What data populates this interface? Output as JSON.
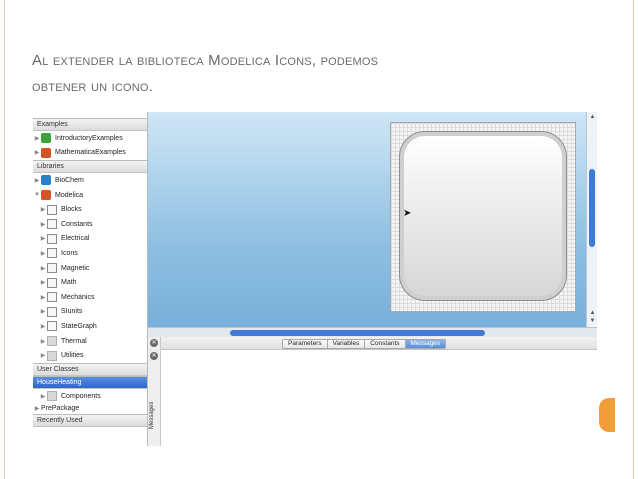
{
  "slide": {
    "title_line1": "Al extender la biblioteca Modelica Icons, podemos",
    "title_line2": "obtener un icono."
  },
  "library": {
    "sections": {
      "examples": "Examples",
      "libraries": "Libraries",
      "user_classes": "User Classes",
      "recently_used": "Recently Used"
    },
    "examples": [
      {
        "label": "IntroductoryExamples",
        "icon": "green-package-icon"
      },
      {
        "label": "MathematicaExamples",
        "icon": "mathematica-icon"
      }
    ],
    "libraries": {
      "biochem": "BioChem",
      "modelica": "Modelica",
      "modelica_children": [
        {
          "label": "Blocks",
          "icon": "blocks-icon"
        },
        {
          "label": "Constants",
          "icon": "constants-icon"
        },
        {
          "label": "Electrical",
          "icon": "electrical-icon"
        },
        {
          "label": "Icons",
          "icon": "icons-icon"
        },
        {
          "label": "Magnetic",
          "icon": "magnetic-icon"
        },
        {
          "label": "Math",
          "icon": "math-icon"
        },
        {
          "label": "Mechanics",
          "icon": "mechanics-icon"
        },
        {
          "label": "SIunits",
          "icon": "siunits-icon"
        },
        {
          "label": "StateGraph",
          "icon": "stategraph-icon"
        },
        {
          "label": "Thermal",
          "icon": "thermal-icon"
        },
        {
          "label": "Utilities",
          "icon": "utilities-icon"
        }
      ]
    },
    "user_classes": {
      "selected": "HouseHeating",
      "child": "Components",
      "other": "PrePackage"
    }
  },
  "tabs": [
    "Parameters",
    "Variables",
    "Constants",
    "Messages"
  ],
  "active_tab": "Messages",
  "side_label": "Messages",
  "colors": {
    "accent": "#3e7ad6",
    "canvas_top": "#cfe6f6",
    "canvas_bottom": "#77aed8",
    "slide_tab": "#f29d3a"
  }
}
